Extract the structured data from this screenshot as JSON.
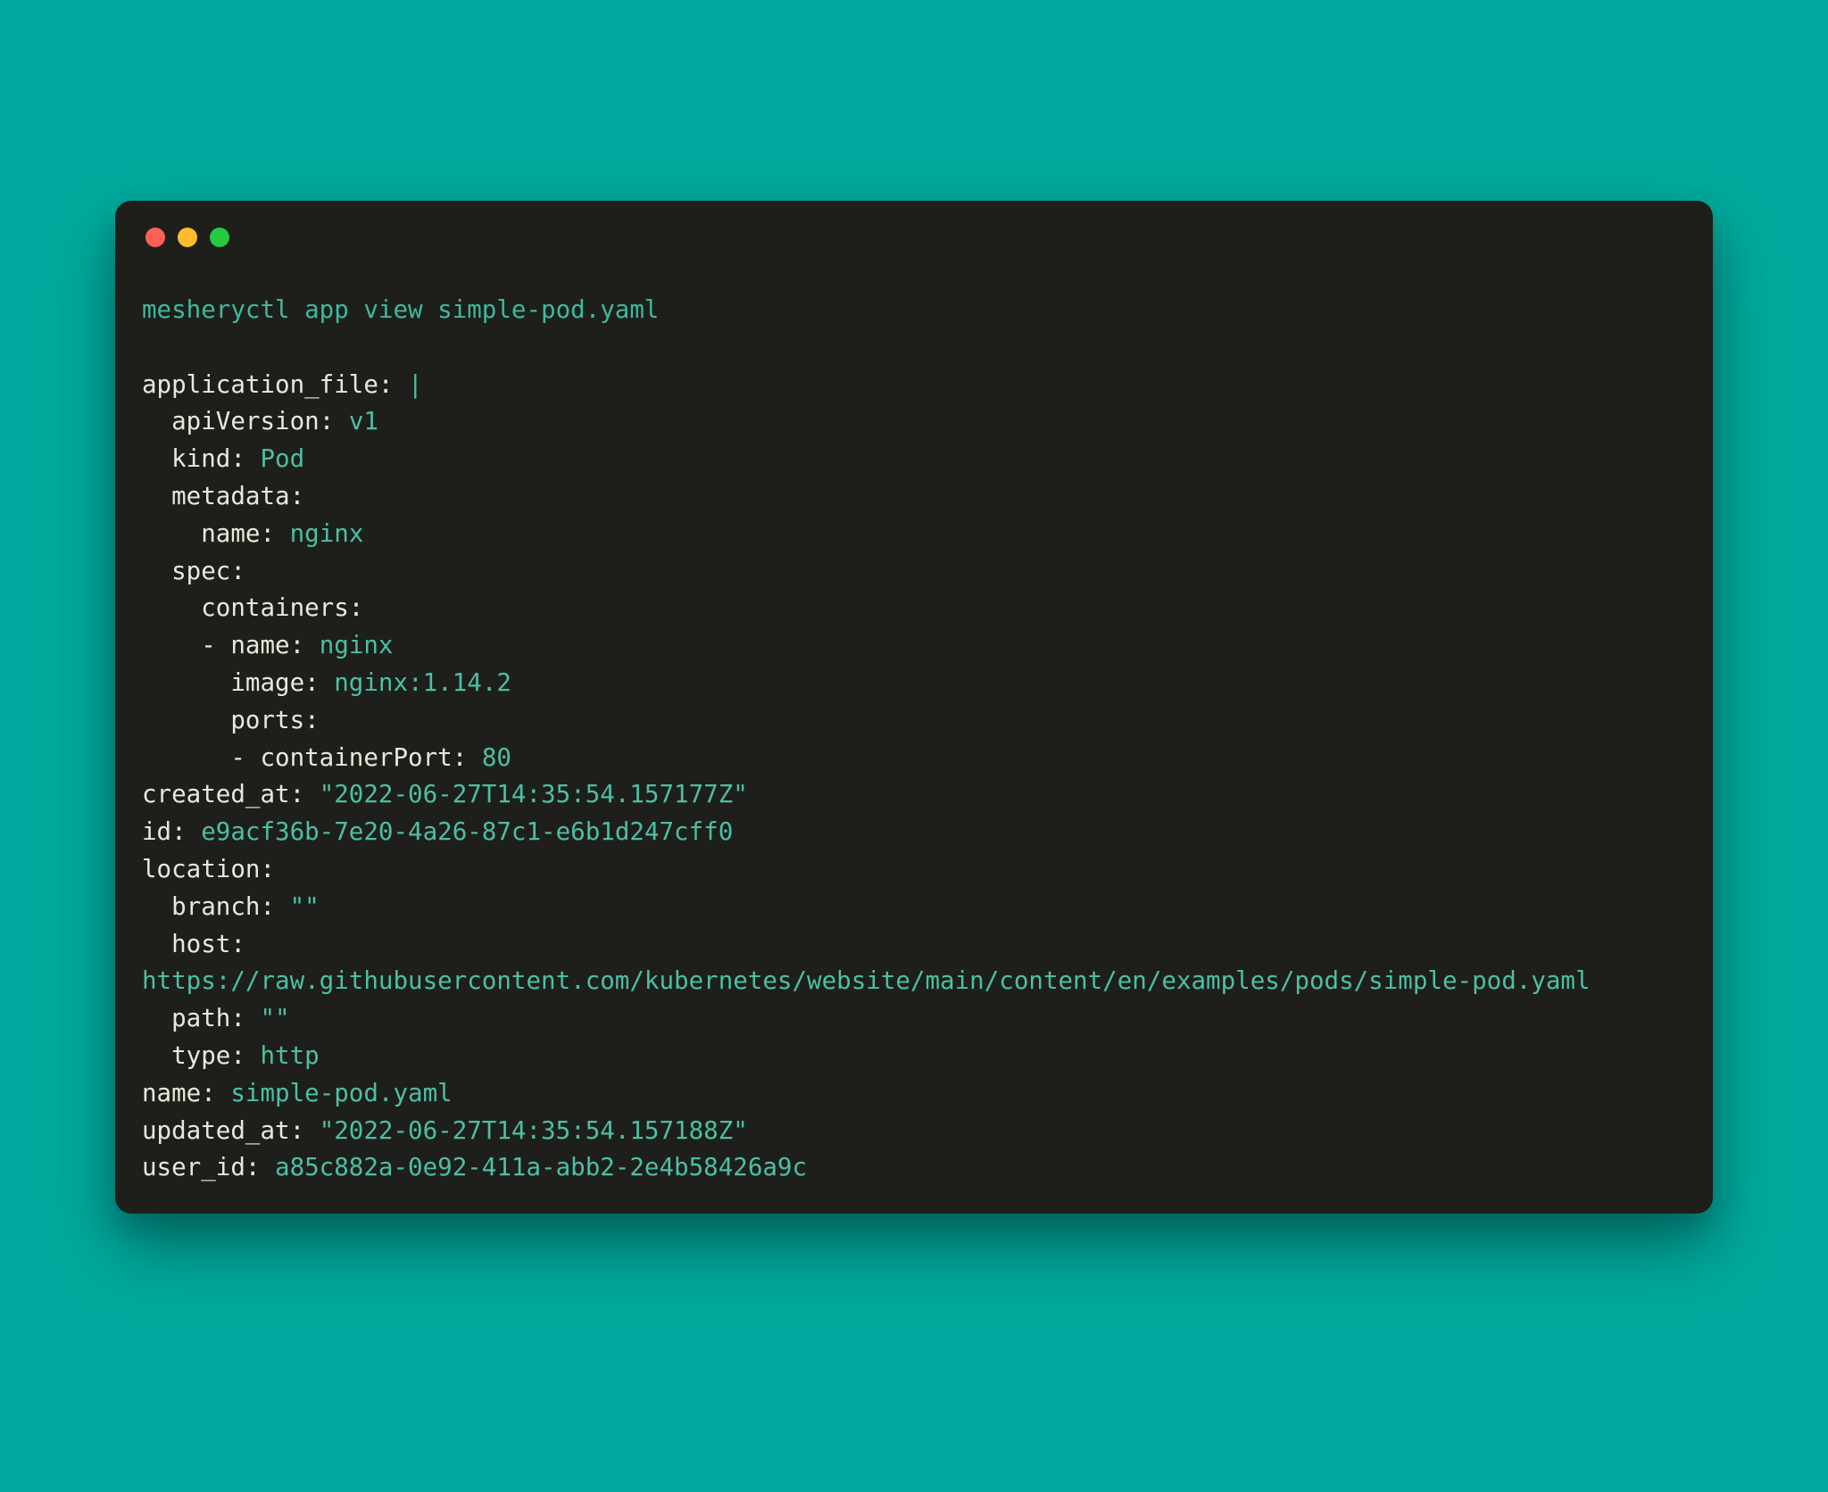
{
  "command": "mesheryctl app view simple-pod.yaml",
  "yaml": {
    "application_file_key": "application_file:",
    "pipe": "|",
    "apiVersion_key": "apiVersion:",
    "apiVersion_val": "v1",
    "kind_key": "kind:",
    "kind_val": "Pod",
    "metadata_key": "metadata:",
    "metadata_name_key": "name:",
    "metadata_name_val": "nginx",
    "spec_key": "spec:",
    "containers_key": "containers:",
    "cname_key": "- name:",
    "cname_val": "nginx",
    "image_key": "image:",
    "image_val": "nginx:1.14.2",
    "ports_key": "ports:",
    "containerPort_key": "- containerPort:",
    "containerPort_val": "80",
    "created_at_key": "created_at:",
    "created_at_val": "\"2022-06-27T14:35:54.157177Z\"",
    "id_key": "id:",
    "id_val": "e9acf36b-7e20-4a26-87c1-e6b1d247cff0",
    "location_key": "location:",
    "branch_key": "branch:",
    "branch_val": "\"\"",
    "host_key": "host:",
    "host_val": "https://raw.githubusercontent.com/kubernetes/website/main/content/en/examples/pods/simple-pod.yaml",
    "path_key": "path:",
    "path_val": "\"\"",
    "type_key": "type:",
    "type_val": "http",
    "name_key": "name:",
    "name_val": "simple-pod.yaml",
    "updated_at_key": "updated_at:",
    "updated_at_val": "\"2022-06-27T14:35:54.157188Z\"",
    "user_id_key": "user_id:",
    "user_id_val": "a85c882a-0e92-411a-abb2-2e4b58426a9c"
  }
}
